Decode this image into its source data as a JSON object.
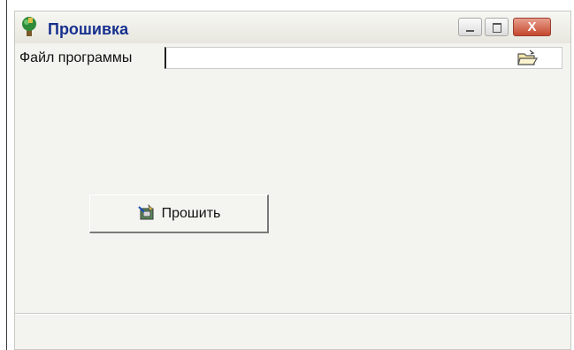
{
  "window": {
    "title": "Прошивка",
    "controls": {
      "minimize_icon": "minimize-icon",
      "maximize_icon": "maximize-icon",
      "close_glyph": "X"
    }
  },
  "form": {
    "file_label": "Файл программы",
    "file_value": "",
    "browse_icon": "folder-open-icon"
  },
  "actions": {
    "flash_label": "Прошить",
    "flash_icon": "flash-chip-icon"
  },
  "colors": {
    "title_text": "#17308e",
    "close_button": "#c6472d",
    "window_bg": "#f3f3ef"
  }
}
